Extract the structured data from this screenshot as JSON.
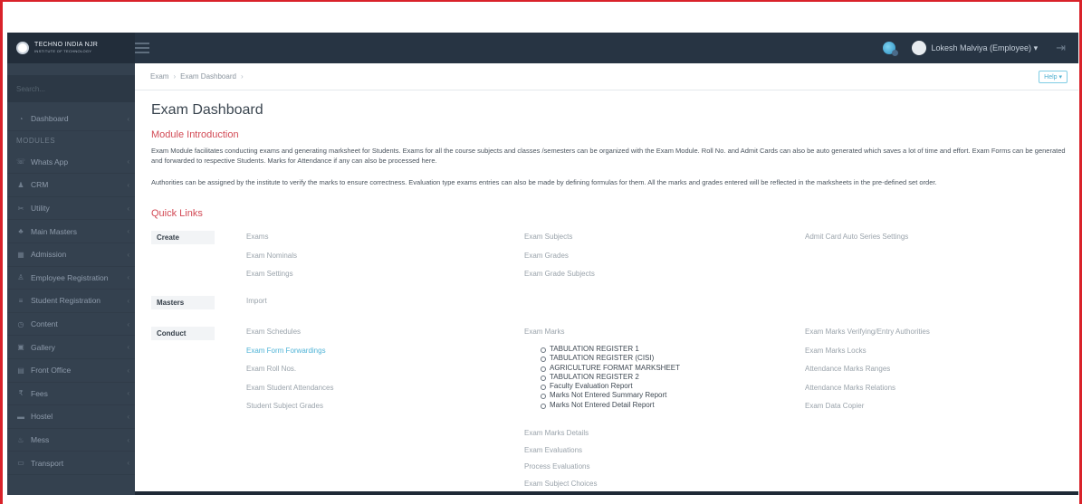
{
  "header": {
    "logo_text": "TECHNO INDIA NJR",
    "logo_sub": "INSTITUTE OF TECHNOLOGY",
    "user": "Lokesh Malviya (Employee)",
    "user_caret": "▾",
    "logout_icon": "logout-icon"
  },
  "sidebar": {
    "search_placeholder": "Search...",
    "dashboard": "Dashboard",
    "section": "MODULES",
    "items": [
      {
        "label": "Whats App",
        "icon": "☏"
      },
      {
        "label": "CRM",
        "icon": "♟"
      },
      {
        "label": "Utility",
        "icon": "✂"
      },
      {
        "label": "Main Masters",
        "icon": "♣"
      },
      {
        "label": "Admission",
        "icon": "▦"
      },
      {
        "label": "Employee Registration",
        "icon": "♙"
      },
      {
        "label": "Student Registration",
        "icon": "≡"
      },
      {
        "label": "Content",
        "icon": "◷"
      },
      {
        "label": "Gallery",
        "icon": "▣"
      },
      {
        "label": "Front Office",
        "icon": "▤"
      },
      {
        "label": "Fees",
        "icon": "₹"
      },
      {
        "label": "Hostel",
        "icon": "▬"
      },
      {
        "label": "Mess",
        "icon": "♨"
      },
      {
        "label": "Transport",
        "icon": "▭"
      }
    ],
    "chevron": "‹"
  },
  "breadcrumb": {
    "root": "Exam",
    "current": "Exam Dashboard",
    "sep": "›"
  },
  "help_label": "Help ▾",
  "page_title": "Exam Dashboard",
  "module_intro_title": "Module Introduction",
  "para1": "Exam Module facilitates conducting exams and generating marksheet for Students. Exams for all the course subjects and classes /semesters can be organized with the Exam Module. Roll No. and Admit Cards can also be auto generated which saves a lot of time and effort. Exam Forms can be generated and forwarded to respective Students. Marks for Attendance if any can also be processed here.",
  "para2": "Authorities can be assigned by the institute to verify the marks to ensure correctness. Evaluation type exams entries can also be made by defining formulas for them. All the marks and grades entered will be reflected in the marksheets in the pre-defined set order.",
  "quick_links_title": "Quick Links",
  "rows": {
    "create": "Create",
    "masters": "Masters",
    "conduct": "Conduct"
  },
  "links": {
    "create_col1": [
      "Exams",
      "Exam Nominals",
      "Exam Settings"
    ],
    "create_col2": [
      "Exam Subjects",
      "Exam Grades",
      "Exam Grade Subjects"
    ],
    "create_col3": [
      "Admit Card Auto Series Settings"
    ],
    "masters_col1": [
      "Import"
    ],
    "conduct_col1": [
      "Exam Schedules",
      "Exam Form Forwardings",
      "Exam Roll Nos.",
      "Exam Student Attendances",
      "Student Subject Grades"
    ],
    "conduct_col2_top": "Exam Marks",
    "conduct_col2_bullets": [
      "TABULATION REGISTER 1",
      "TABULATION REGISTER (CISI)",
      "AGRICULTURE FORMAT MARKSHEET",
      "TABULATION REGISTER 2",
      "Faculty Evaluation Report",
      "Marks Not Entered Summary Report",
      "Marks Not Entered Detail Report"
    ],
    "conduct_col2_bottom": [
      "Exam Marks Details",
      "Exam Evaluations",
      "Process Evaluations",
      "Exam Subject Choices"
    ],
    "conduct_col3": [
      "Exam Marks Verifying/Entry Authorities",
      "Exam Marks Locks",
      "Attendance Marks Ranges",
      "Attendance Marks Relations",
      "Exam Data Copier"
    ]
  }
}
